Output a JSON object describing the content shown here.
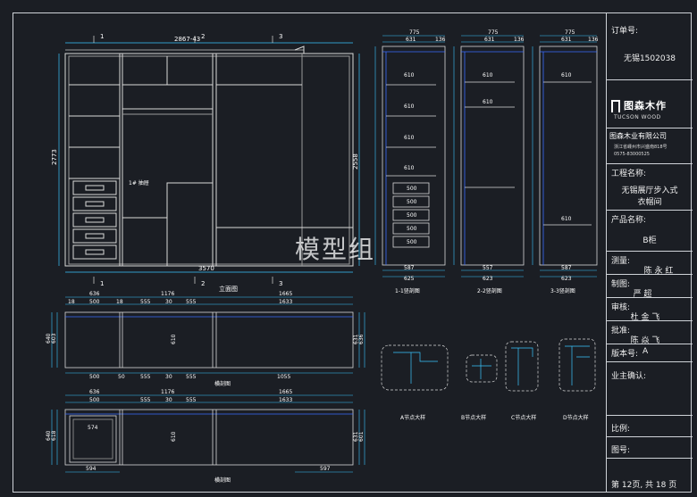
{
  "drawing": {
    "watermark": "模型组",
    "elevation": {
      "top_dim": "2867-43",
      "overall_width": "3570",
      "left_height": "2773",
      "right_height": "2558",
      "title": "立面图",
      "section_marks": [
        "1",
        "2",
        "3"
      ],
      "note": "1#\n抽屉"
    },
    "plan1": {
      "title": "横剖图",
      "top_dims_row1": [
        "636",
        "1176",
        "1665"
      ],
      "top_dims_row2": [
        "18",
        "500",
        "18",
        "18",
        "555",
        "30",
        "555",
        "18",
        "18",
        "1633",
        "18"
      ],
      "bottom_dims": [
        "18",
        "500",
        "50",
        "555",
        "30",
        "555",
        "18",
        "1055"
      ],
      "left_dims": [
        "640",
        "603"
      ],
      "right_dims": [
        "631",
        "636"
      ],
      "inner_dim": "610"
    },
    "plan2": {
      "title": "横剖图",
      "top_dims_row1": [
        "636",
        "1176",
        "1665"
      ],
      "top_dims_row2": [
        "18",
        "500",
        "18",
        "18",
        "555",
        "30",
        "555",
        "18",
        "18",
        "1633",
        "18"
      ],
      "left_dims": [
        "640",
        "618"
      ],
      "drawer_dim": "574",
      "bottom_dim_left": "594",
      "bottom_dim_right": "597",
      "right_dims": [
        "631",
        "601"
      ],
      "inner_dim": "610"
    },
    "sections": [
      {
        "title": "1-1竖剖图",
        "top": "775",
        "top2": [
          "631",
          "136"
        ],
        "bottom": [
          "587",
          "625"
        ],
        "shelf": "610",
        "drawer": "500"
      },
      {
        "title": "2-2竖剖图",
        "top": "775",
        "top2": [
          "631",
          "136"
        ],
        "bottom": [
          "557",
          "623"
        ],
        "shelf": "610"
      },
      {
        "title": "3-3竖剖图",
        "top": "775",
        "top2": [
          "631",
          "136"
        ],
        "bottom": [
          "587",
          "623"
        ],
        "shelf": "610"
      }
    ],
    "details": [
      "A节点大样",
      "B节点大样",
      "C节点大样",
      "D节点大样"
    ]
  },
  "title_block": {
    "order_label": "订单号:",
    "order_value": "无锡1502038",
    "brand_cn": "图森木作",
    "brand_en": "TUCSON WOOD",
    "company": "图森木业有限公司",
    "address_line1": "浙江省嵊州市兴盛南818号",
    "address_line2": "0575-83000525",
    "project_label": "工程名称:",
    "project_value_1": "无锡展厅步入式",
    "project_value_2": "衣帽间",
    "product_label": "产品名称:",
    "product_value": "B柜",
    "survey_label": "测量:",
    "survey_value": "陈 永 红",
    "drawn_label": "制图:",
    "drawn_value": "严 超",
    "review_label": "审核:",
    "review_value": "杜 金 飞",
    "approve_label": "批准:",
    "approve_value": "陈 焱 飞",
    "version_label": "版本号:",
    "version_value": "A",
    "owner_label": "业主确认:",
    "scale_label": "比例:",
    "drawing_no_label": "图号:",
    "page_info": "第 12页, 共 18 页"
  }
}
